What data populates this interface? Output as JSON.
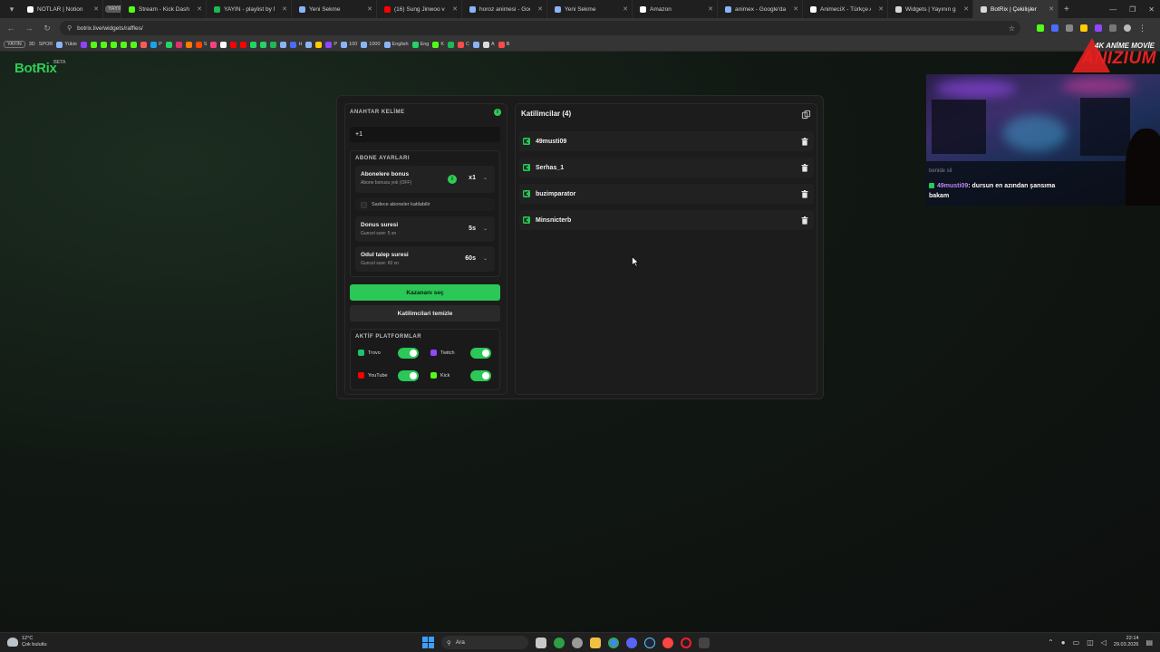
{
  "browser": {
    "tabs": [
      {
        "label": "NOTLAR | Notion",
        "color": "#ffffff"
      },
      {
        "label": "YAYIN",
        "color": "#9a9a9a",
        "pill": true
      },
      {
        "label": "Stream - Kick Dashb...",
        "color": "#53fc18"
      },
      {
        "label": "YAYIN - playlist by M...",
        "color": "#1db954"
      },
      {
        "label": "Yeni Sekme",
        "color": "#8ab4f8"
      },
      {
        "label": "(16) Sung Jinwoo vs T...",
        "color": "#ff0000"
      },
      {
        "label": "horoz animesi - Goog...",
        "color": "#8ab4f8"
      },
      {
        "label": "Yeni Sekme",
        "color": "#8ab4f8"
      },
      {
        "label": "Amazon",
        "color": "#ffffff"
      },
      {
        "label": "animex - Google'da A...",
        "color": "#8ab4f8"
      },
      {
        "label": "AnimeciX - Türkçe An...",
        "color": "#ffffff"
      },
      {
        "label": "Widgets | Yayının gü...",
        "color": "#d8d8d8"
      },
      {
        "label": "BotRix | Çekilişler",
        "color": "#d8d8d8",
        "active": true
      }
    ],
    "url": "botrix.live/widgets/raffles/",
    "bookmarks": [
      {
        "label": "YAYIN",
        "pill": true,
        "color": ""
      },
      {
        "label": "3D",
        "color": ""
      },
      {
        "label": "SPOR",
        "color": ""
      },
      {
        "label": "Yükle",
        "color": "#8ab4f8"
      },
      {
        "label": "",
        "color": "#8e44ff"
      },
      {
        "label": "",
        "color": "#53fc18"
      },
      {
        "label": "",
        "color": "#53fc18"
      },
      {
        "label": "",
        "color": "#53fc18"
      },
      {
        "label": "",
        "color": "#53fc18"
      },
      {
        "label": "",
        "color": "#53fc18"
      },
      {
        "label": "",
        "color": "#ff5a5a"
      },
      {
        "label": "P",
        "color": "#1da1f2"
      },
      {
        "label": "",
        "color": "#25d366"
      },
      {
        "label": "",
        "color": "#e1306c"
      },
      {
        "label": "",
        "color": "#ff7a00"
      },
      {
        "label": "S",
        "color": "#ff4500"
      },
      {
        "label": "",
        "color": "#ff4081"
      },
      {
        "label": "",
        "color": "#ffffff"
      },
      {
        "label": "",
        "color": "#ff0000"
      },
      {
        "label": "",
        "color": "#ff0000"
      },
      {
        "label": "",
        "color": "#25d366"
      },
      {
        "label": "",
        "color": "#25d366"
      },
      {
        "label": "",
        "color": "#1db954"
      },
      {
        "label": "",
        "color": "#8ab4f8"
      },
      {
        "label": "H",
        "color": "#4a6cff"
      },
      {
        "label": "",
        "color": "#8ab4f8"
      },
      {
        "label": "",
        "color": "#ffcc00"
      },
      {
        "label": "P",
        "color": "#9146ff"
      },
      {
        "label": "100",
        "color": "#8ab4f8"
      },
      {
        "label": "1000",
        "color": "#8ab4f8"
      },
      {
        "label": "English",
        "color": "#8ab4f8"
      },
      {
        "label": "Eng",
        "color": "#25d366"
      },
      {
        "label": "K",
        "color": "#53fc18"
      },
      {
        "label": "",
        "color": "#1db954"
      },
      {
        "label": "C",
        "color": "#ff4a4a"
      },
      {
        "label": "",
        "color": "#8ab4f8"
      },
      {
        "label": "A",
        "color": "#dddddd"
      },
      {
        "label": "B",
        "color": "#ff4a4a"
      }
    ]
  },
  "app": {
    "logo": "BotRix",
    "logo_badge": "BETA",
    "keyword": {
      "title": "ANAHTAR KELİME",
      "value": "+1"
    },
    "subscriber": {
      "title": "ABONE AYARLARI",
      "bonus_title": "Abonelere bonus",
      "bonus_sub": "Abone bonusu yok (OFF)",
      "bonus_value": "x1",
      "only_subs_label": "Sadece aboneler katilabilir",
      "bonus_duration_title": "Donus suresi",
      "bonus_duration_sub": "Guncel sure: 5 sn",
      "bonus_duration_value": "5s",
      "claim_title": "Odul talep suresi",
      "claim_sub": "Guncel sure: 60 sn",
      "claim_value": "60s"
    },
    "pick_winner_label": "Kazananı seç",
    "clear_label": "Katilimcilari temizle",
    "platforms": {
      "title": "AKTİF PLATFORMLAR",
      "items": [
        {
          "name": "Trovo",
          "color": "#1fc26a",
          "on": true
        },
        {
          "name": "Twitch",
          "color": "#9146ff",
          "on": true
        },
        {
          "name": "YouTube",
          "color": "#ff0000",
          "on": true
        },
        {
          "name": "Kick",
          "color": "#53fc18",
          "on": true
        }
      ]
    },
    "participants": {
      "title": "Katilimcilar (4)",
      "items": [
        {
          "name": "49musti09"
        },
        {
          "name": "Serhas_1"
        },
        {
          "name": "buzimparator"
        },
        {
          "name": "Minsnicterb"
        }
      ]
    }
  },
  "overlay": {
    "brand_top": "4K ANİME MOVİE",
    "brand_main": "ANIZIUM",
    "chat_ghost": "benide sil",
    "chat_user": "49musti09",
    "chat_text": ": dursun en azından şansıma bakam"
  },
  "taskbar": {
    "temperature": "12°C",
    "weather": "Çok bulutlu",
    "search_placeholder": "Ara",
    "time": "22:14",
    "date": "29.03.2026"
  },
  "colors": {
    "accent": "#2bc757",
    "panel": "#1b1b1b",
    "background": "#111813"
  }
}
